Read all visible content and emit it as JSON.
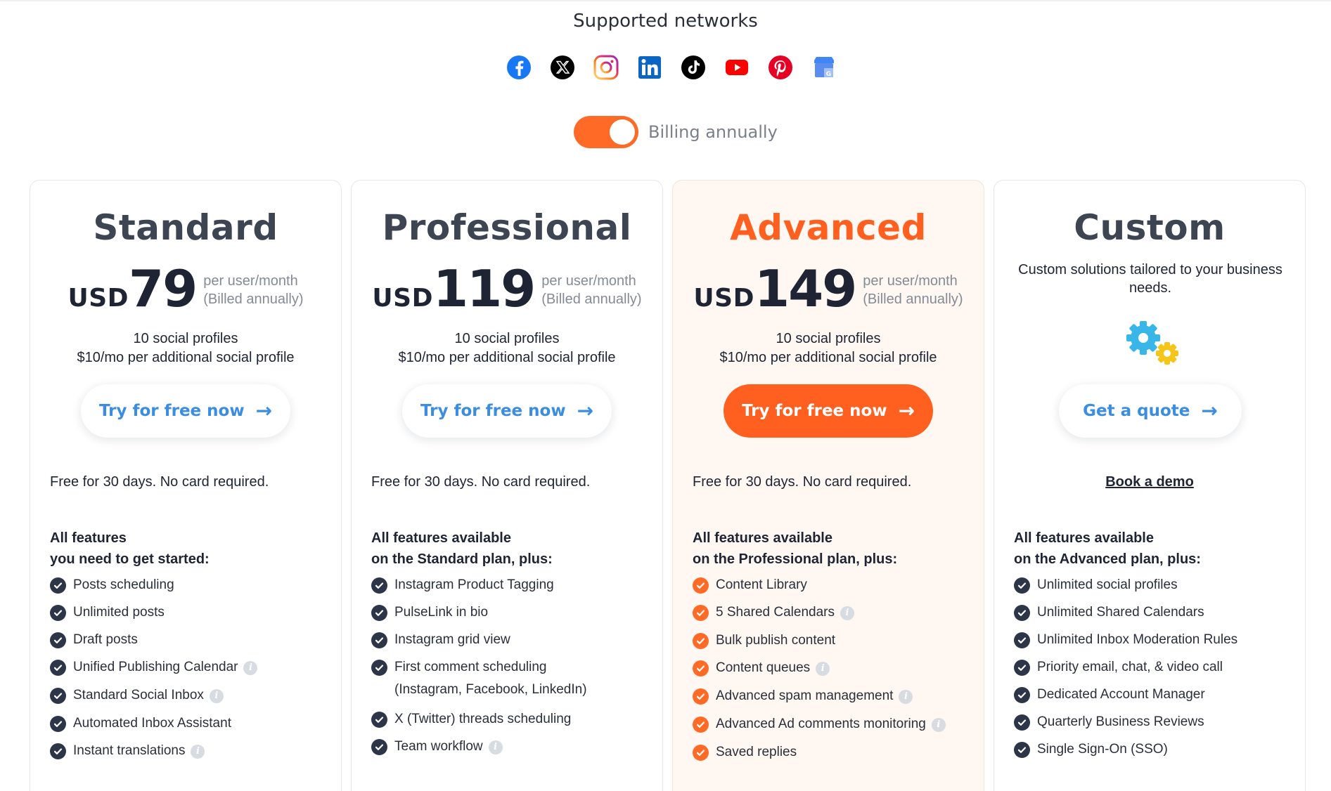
{
  "header": {
    "networks_title": "Supported networks",
    "networks": [
      {
        "icon": "facebook-icon",
        "color": "#1877f2"
      },
      {
        "icon": "x-twitter-icon",
        "color": "#000000"
      },
      {
        "icon": "instagram-icon",
        "color": "#e1306c"
      },
      {
        "icon": "linkedin-icon",
        "color": "#0a66c2"
      },
      {
        "icon": "tiktok-icon",
        "color": "#000000"
      },
      {
        "icon": "youtube-icon",
        "color": "#ff0000"
      },
      {
        "icon": "pinterest-icon",
        "color": "#e60023"
      },
      {
        "icon": "google-business-icon",
        "color": "#4285f4"
      }
    ],
    "billing_label": "Billing annually",
    "billing_toggle_on": true
  },
  "colors": {
    "accent": "#ff6a26",
    "link_blue": "#3a8de0",
    "dark_text": "#1e2433",
    "check_dark": "#2d3548"
  },
  "plans": [
    {
      "name": "Standard",
      "currency": "USD",
      "amount": "79",
      "per_line1": "per user/month",
      "per_line2": "(Billed annually)",
      "profiles_line1": "10 social profiles",
      "profiles_line2": "$10/mo per additional social profile",
      "cta": "Try for free now",
      "note": "Free for 30 days. No card required.",
      "features_head_line1": "All features",
      "features_head_line2": "you need to get started:",
      "features": [
        {
          "label": "Posts scheduling",
          "info": false
        },
        {
          "label": "Unlimited posts",
          "info": false
        },
        {
          "label": "Draft posts",
          "info": false
        },
        {
          "label": "Unified Publishing Calendar",
          "info": true
        },
        {
          "label": "Standard Social Inbox",
          "info": true
        },
        {
          "label": "Automated Inbox Assistant",
          "info": false
        },
        {
          "label": "Instant translations",
          "info": true
        }
      ]
    },
    {
      "name": "Professional",
      "currency": "USD",
      "amount": "119",
      "per_line1": "per user/month",
      "per_line2": "(Billed annually)",
      "profiles_line1": "10 social profiles",
      "profiles_line2": "$10/mo per additional social profile",
      "cta": "Try for free now",
      "note": "Free for 30 days. No card required.",
      "features_head_line1": "All features available",
      "features_head_line2": "on the Standard plan, plus:",
      "features": [
        {
          "label": "Instagram Product Tagging",
          "info": false
        },
        {
          "label": "PulseLink in bio",
          "info": false
        },
        {
          "label": "Instagram grid view",
          "info": false
        },
        {
          "label": "First comment scheduling",
          "label2": "(Instagram, Facebook, LinkedIn)",
          "info": false
        },
        {
          "label": "X (Twitter) threads scheduling",
          "info": false
        },
        {
          "label": "Team workflow",
          "info": true
        }
      ]
    },
    {
      "name": "Advanced",
      "currency": "USD",
      "amount": "149",
      "per_line1": "per user/month",
      "per_line2": "(Billed annually)",
      "profiles_line1": "10 social profiles",
      "profiles_line2": "$10/mo per additional social profile",
      "cta": "Try for free now",
      "note": "Free for 30 days. No card required.",
      "features_head_line1": "All features available",
      "features_head_line2": "on the Professional plan, plus:",
      "features": [
        {
          "label": "Content Library",
          "info": false
        },
        {
          "label": "5 Shared Calendars",
          "info": true
        },
        {
          "label": "Bulk publish content",
          "info": false
        },
        {
          "label": "Content queues",
          "info": true
        },
        {
          "label": "Advanced spam management",
          "info": true
        },
        {
          "label": "Advanced Ad comments monitoring",
          "info": true
        },
        {
          "label": "Saved replies",
          "info": false
        }
      ]
    },
    {
      "name": "Custom",
      "description": "Custom solutions tailored to your business needs.",
      "cta": "Get a quote",
      "book_demo": "Book a demo",
      "features_head_line1": "All features available",
      "features_head_line2": "on the Advanced plan, plus:",
      "features": [
        {
          "label": "Unlimited social profiles",
          "info": false
        },
        {
          "label": "Unlimited Shared Calendars",
          "info": false
        },
        {
          "label": "Unlimited Inbox Moderation Rules",
          "info": false
        },
        {
          "label": "Priority email, chat, & video call",
          "info": false
        },
        {
          "label": "Dedicated Account Manager",
          "info": false
        },
        {
          "label": "Quarterly Business Reviews",
          "info": false
        },
        {
          "label": "Single Sign-On (SSO)",
          "info": false
        }
      ]
    }
  ]
}
